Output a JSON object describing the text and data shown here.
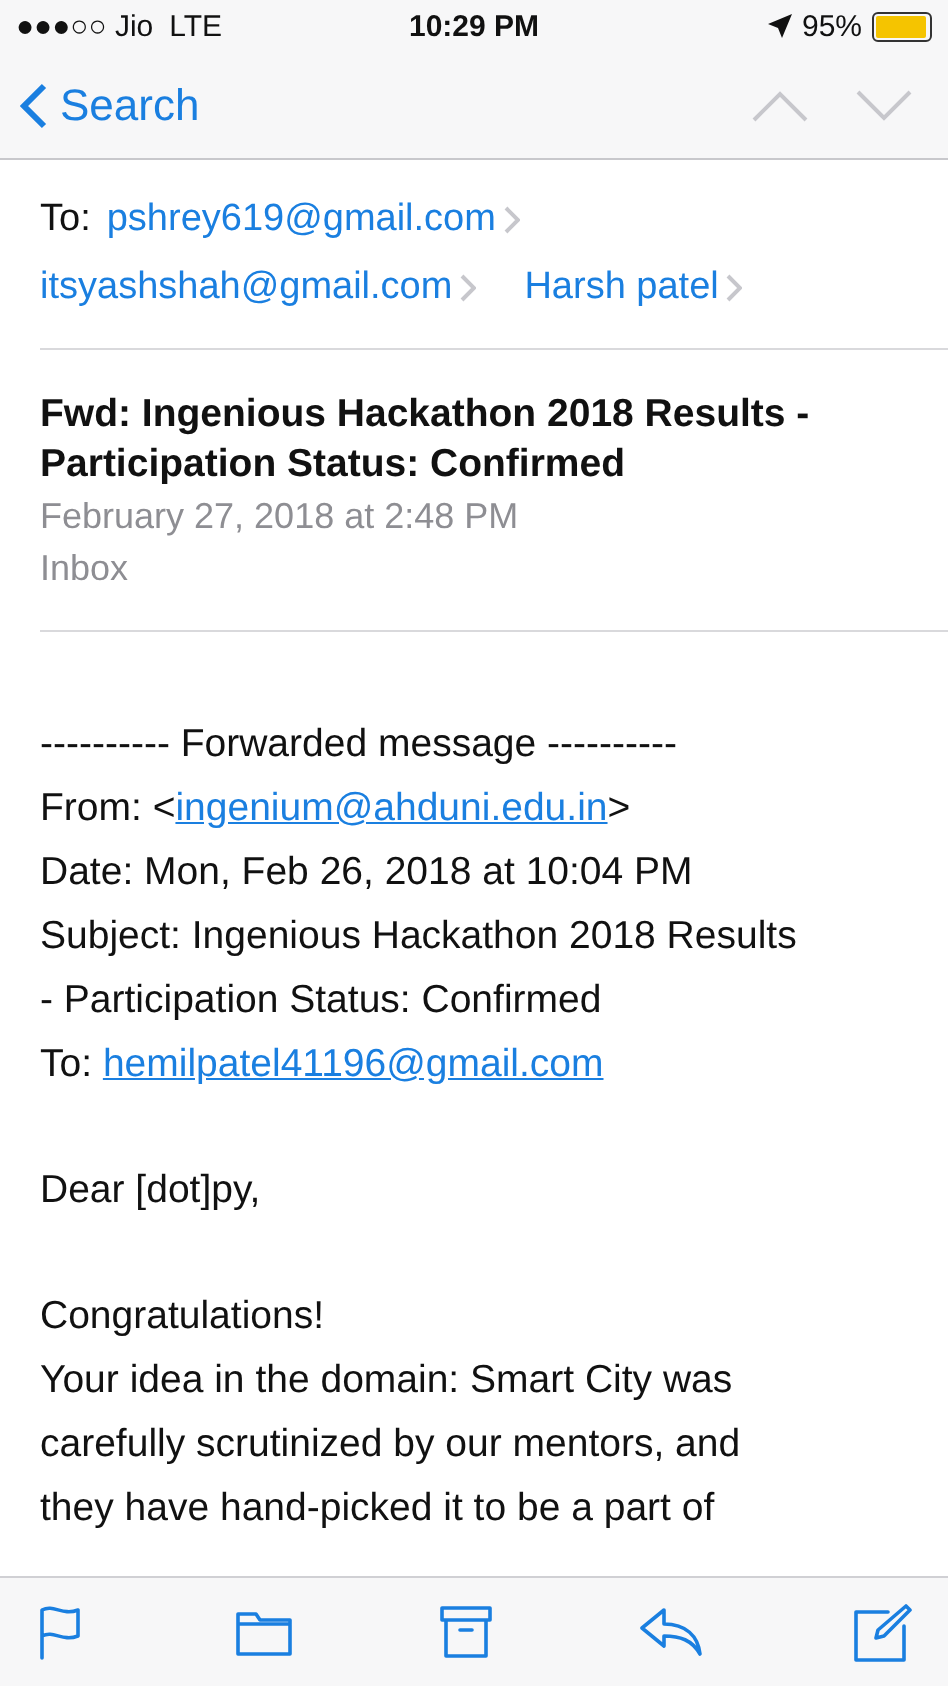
{
  "status_bar": {
    "carrier": "●●●○○ Jio",
    "network": "LTE",
    "time": "10:29 PM",
    "battery": "95%",
    "battery_meter": {
      "level": 0.95
    }
  },
  "nav": {
    "back": "Search"
  },
  "recipients": {
    "label": "To:",
    "rows": [
      [
        "pshrey619@gmail.com"
      ],
      [
        "itsyashshah@gmail.com",
        "Harsh patel"
      ]
    ]
  },
  "header": {
    "subject": "Fwd: Ingenious Hackathon 2018 Results - Participation Status: Confirmed",
    "date": "February 27, 2018 at 2:48 PM",
    "mailbox": "Inbox"
  },
  "body": [
    [
      [
        {
          "kind": "plain",
          "text": "---------- Forwarded message ----------"
        }
      ],
      [
        {
          "kind": "plain",
          "text": "From: <"
        },
        {
          "kind": "link",
          "text": "ingenium@ahduni.edu.in"
        },
        {
          "kind": "plain",
          "text": ">"
        }
      ],
      [
        {
          "kind": "plain",
          "text": "Date: Mon, Feb 26, 2018 at 10:04 PM"
        }
      ],
      [
        {
          "kind": "plain",
          "text": "Subject: Ingenious Hackathon 2018 Results"
        }
      ],
      [
        {
          "kind": "plain",
          "text": "- Participation Status: Confirmed"
        }
      ],
      [
        {
          "kind": "plain",
          "text": "To: "
        },
        {
          "kind": "link",
          "text": "hemilpatel41196@gmail.com"
        }
      ]
    ],
    [
      [
        {
          "kind": "plain",
          "text": "Dear [dot]py,"
        }
      ]
    ],
    [
      [
        {
          "kind": "plain",
          "text": "Congratulations!"
        }
      ],
      [
        {
          "kind": "plain",
          "text": "Your idea in the domain: Smart City was"
        }
      ],
      [
        {
          "kind": "plain",
          "text": "carefully scrutinized by our mentors, and"
        }
      ],
      [
        {
          "kind": "plain",
          "text": "they have hand-picked it to be a part of"
        }
      ]
    ]
  ],
  "toolbar": [
    {
      "kind": "flag"
    },
    {
      "kind": "folder"
    },
    {
      "kind": "archive"
    },
    {
      "kind": "reply"
    },
    {
      "kind": "compose"
    }
  ]
}
